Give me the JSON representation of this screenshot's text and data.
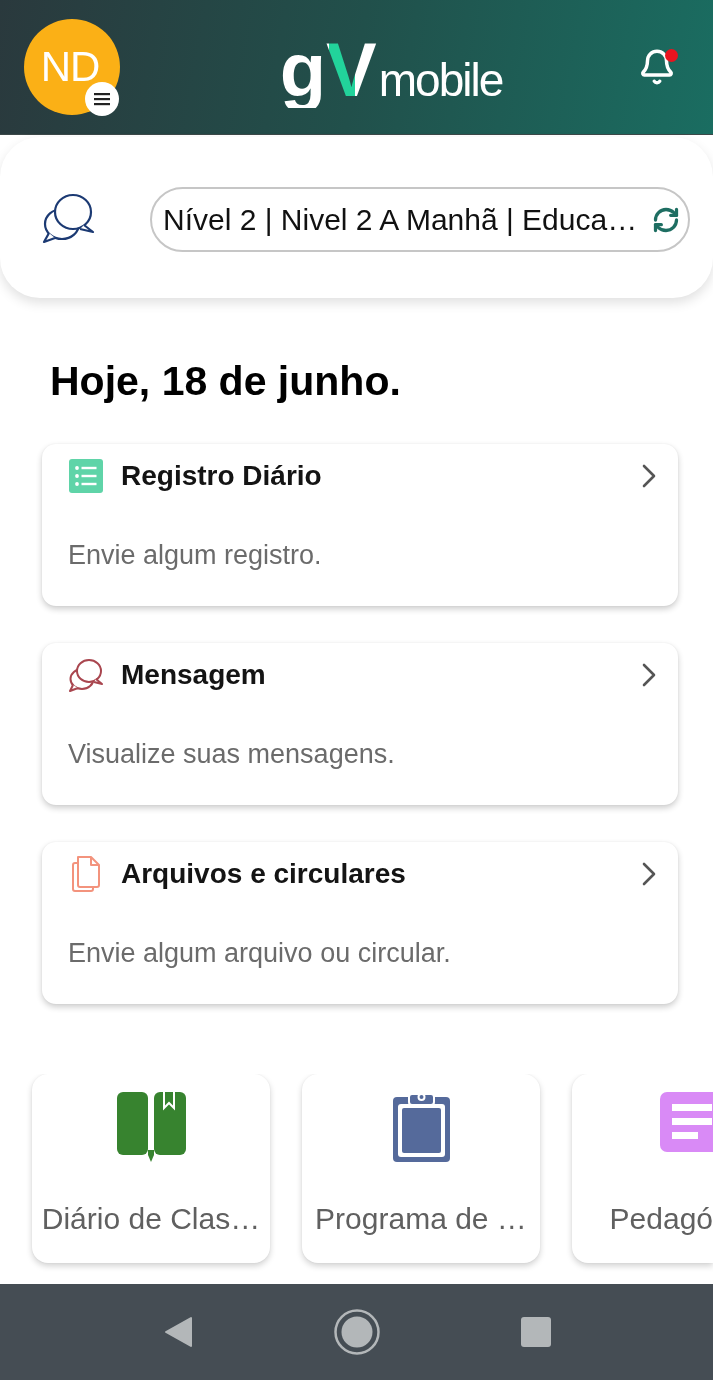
{
  "header": {
    "avatar": {
      "initials": "ND"
    },
    "logo": {
      "mark": "gV",
      "word": "mobile"
    },
    "notifications": {
      "unread": true
    }
  },
  "context": {
    "class_selector": {
      "value": "Nível 2 | Nivel 2 A Manhã | Educa…"
    }
  },
  "greeting": "Hoje, 18 de junho.",
  "cards": [
    {
      "kind": "list",
      "color": "#5fd4a8",
      "title": "Registro Diário",
      "subtitle": "Envie algum registro."
    },
    {
      "kind": "chat",
      "color": "#a9464f",
      "title": "Mensagem",
      "subtitle": "Visualize suas mensagens."
    },
    {
      "kind": "files",
      "color": "#f3937d",
      "title": "Arquivos e circulares",
      "subtitle": "Envie algum arquivo ou circular."
    }
  ],
  "tiles": [
    {
      "kind": "book",
      "color": "#37832f",
      "label": "Diário de Clas…"
    },
    {
      "kind": "clipboard",
      "color": "#556a9b",
      "label": "Programa de …"
    },
    {
      "kind": "notes",
      "color": "#d98af6",
      "label": "Pedagó"
    }
  ]
}
